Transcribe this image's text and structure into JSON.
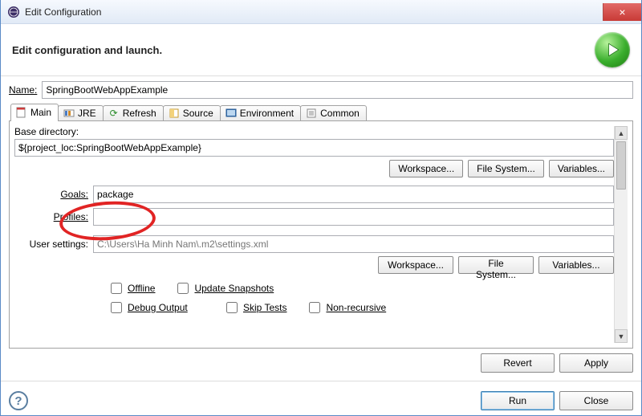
{
  "window": {
    "title": "Edit Configuration"
  },
  "header": {
    "title": "Edit configuration and launch."
  },
  "name": {
    "label": "Name:",
    "value": "SpringBootWebAppExample"
  },
  "tabs": {
    "main": "Main",
    "jre": "JRE",
    "refresh": "Refresh",
    "source": "Source",
    "environment": "Environment",
    "common": "Common"
  },
  "main_tab": {
    "base_dir_label": "Base directory:",
    "base_dir_value": "${project_loc:SpringBootWebAppExample}",
    "workspace_btn": "Workspace...",
    "filesystem_btn": "File System...",
    "variables_btn": "Variables...",
    "goals_label": "Goals:",
    "goals_value": "package",
    "profiles_label": "Profiles:",
    "user_settings_label": "User settings:",
    "user_settings_value": "C:\\Users\\Ha Minh Nam\\.m2\\settings.xml",
    "offline": "Offline",
    "update_snapshots": "Update Snapshots",
    "debug_output": "Debug Output",
    "skip_tests": "Skip Tests",
    "non_recursive": "Non-recursive"
  },
  "buttons": {
    "revert": "Revert",
    "apply": "Apply",
    "run": "Run",
    "close": "Close"
  },
  "icons": {
    "window": "eclipse-icon",
    "close": "×",
    "main": "📄",
    "refresh_glyph": "⟳",
    "source_glyph": "◧",
    "up": "▲",
    "down": "▼"
  }
}
